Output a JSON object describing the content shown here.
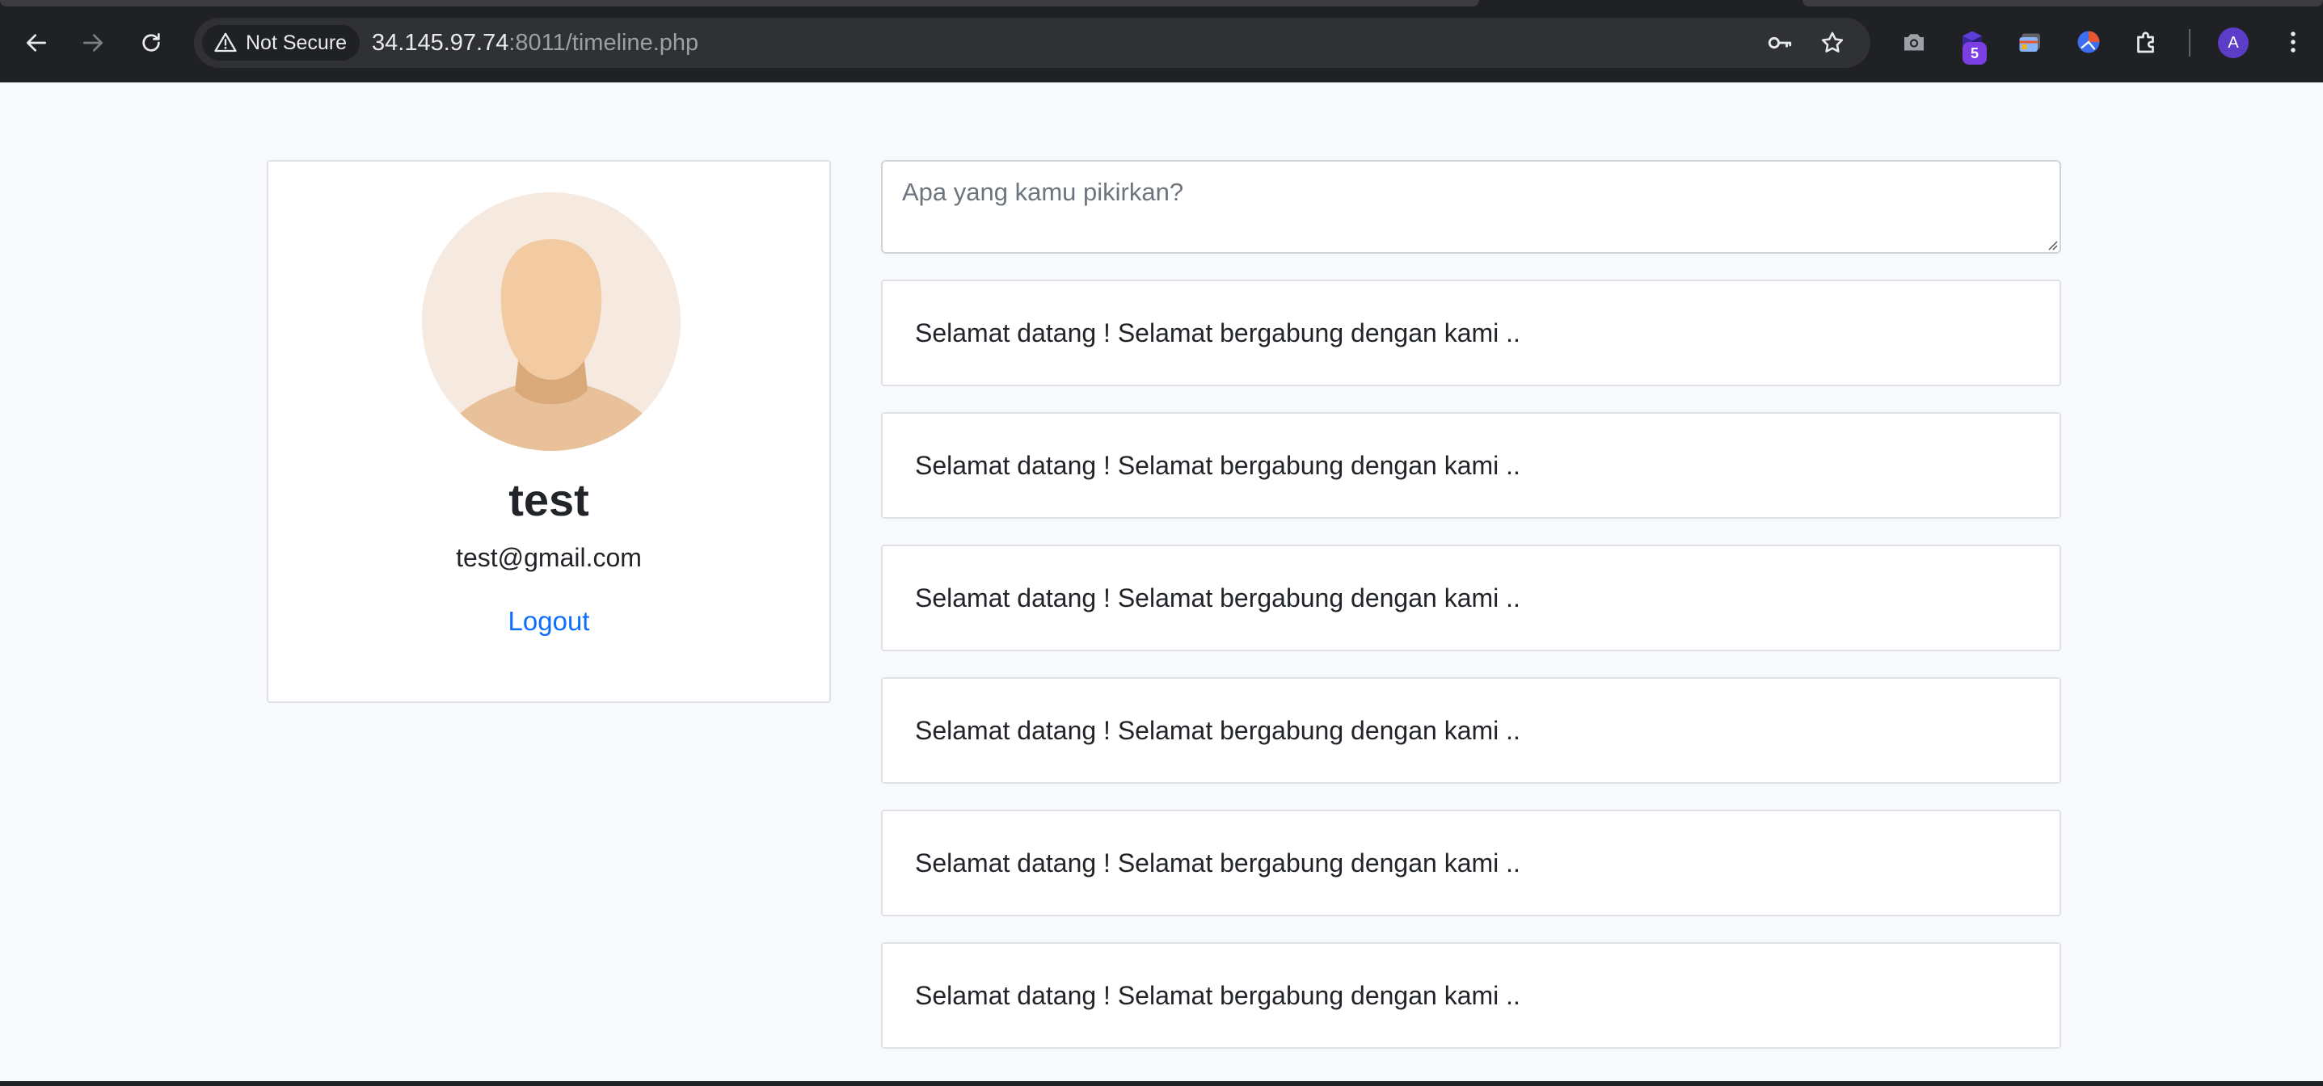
{
  "browser": {
    "security_label": "Not Secure",
    "url_host": "34.145.97.74",
    "url_path": ":8011/timeline.php",
    "extension_badge": "5",
    "profile_initial": "A",
    "icons": {
      "back": "arrow-left-icon",
      "forward": "arrow-right-icon",
      "reload": "reload-icon",
      "warning": "warning-triangle-icon",
      "password": "key-icon",
      "bookmark": "star-icon",
      "screenshot": "camera-icon",
      "extension_stack": "layered-cube-icon",
      "browser_ext": "browser-window-icon",
      "globe_ext": "globe-icon",
      "extensions": "puzzle-icon",
      "menu": "kebab-menu-icon"
    },
    "colors": {
      "chrome_bg": "#202124",
      "omnibox_bg": "#303134",
      "badge": "#7b3fe4",
      "avatar": "#5c3dc7"
    }
  },
  "profile": {
    "name": "test",
    "email": "test@gmail.com",
    "logout_label": "Logout",
    "colors": {
      "link": "#0d6efd",
      "avatar_bg": "#f5e9e0",
      "skin": "#f3cba3"
    }
  },
  "composer": {
    "placeholder": "Apa yang kamu pikirkan?",
    "value": ""
  },
  "posts": [
    {
      "text": "Selamat datang ! Selamat bergabung dengan kami .."
    },
    {
      "text": "Selamat datang ! Selamat bergabung dengan kami .."
    },
    {
      "text": "Selamat datang ! Selamat bergabung dengan kami .."
    },
    {
      "text": "Selamat datang ! Selamat bergabung dengan kami .."
    },
    {
      "text": "Selamat datang ! Selamat bergabung dengan kami .."
    },
    {
      "text": "Selamat datang ! Selamat bergabung dengan kami .."
    }
  ]
}
